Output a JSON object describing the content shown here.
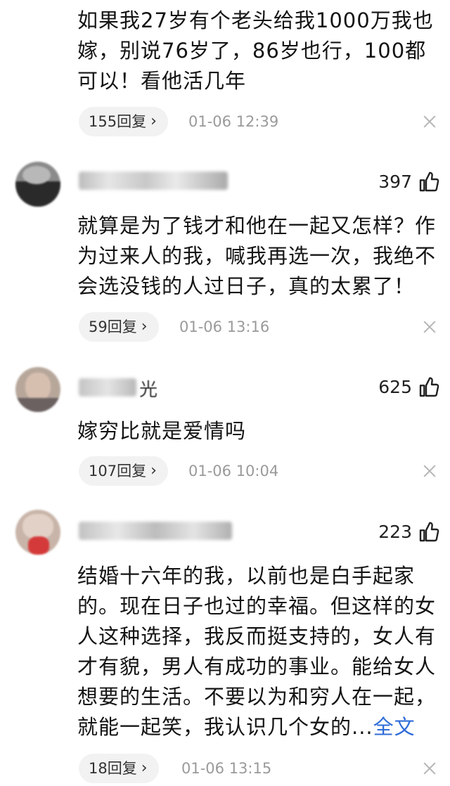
{
  "comments": [
    {
      "text": "如果我27岁有个老头给我1000万我也嫁，别说76岁了，86岁也行，100都可以！看他活几年",
      "replies": "155回复",
      "time": "01-06 12:39"
    },
    {
      "likes": "397",
      "text": "就算是为了钱才和他在一起又怎样？作为过来人的我，喊我再选一次，我绝不会选没钱的人过日子，真的太累了！",
      "replies": "59回复",
      "time": "01-06 13:16"
    },
    {
      "username_tail": "光",
      "likes": "625",
      "text": "嫁穷比就是爱情吗",
      "replies": "107回复",
      "time": "01-06 10:04"
    },
    {
      "likes": "223",
      "text": "结婚十六年的我，以前也是白手起家的。现在日子也过的幸福。但这样的女人这种选择，我反而挺支持的，女人有才有貌，男人有成功的事业。能给女人想要的生活。不要以为和穷人在一起，就能一起笑，我认识几个女的...",
      "more": "全文",
      "replies": "18回复",
      "time": "01-06 13:15"
    }
  ],
  "icons": {
    "reply_chevron": "chevron-right-icon",
    "like": "thumbs-up-icon",
    "dismiss": "close-icon"
  },
  "colors": {
    "link": "#2f6cd8",
    "pill_bg": "#f2f2f2",
    "meta_gray": "#9a9a9a"
  }
}
